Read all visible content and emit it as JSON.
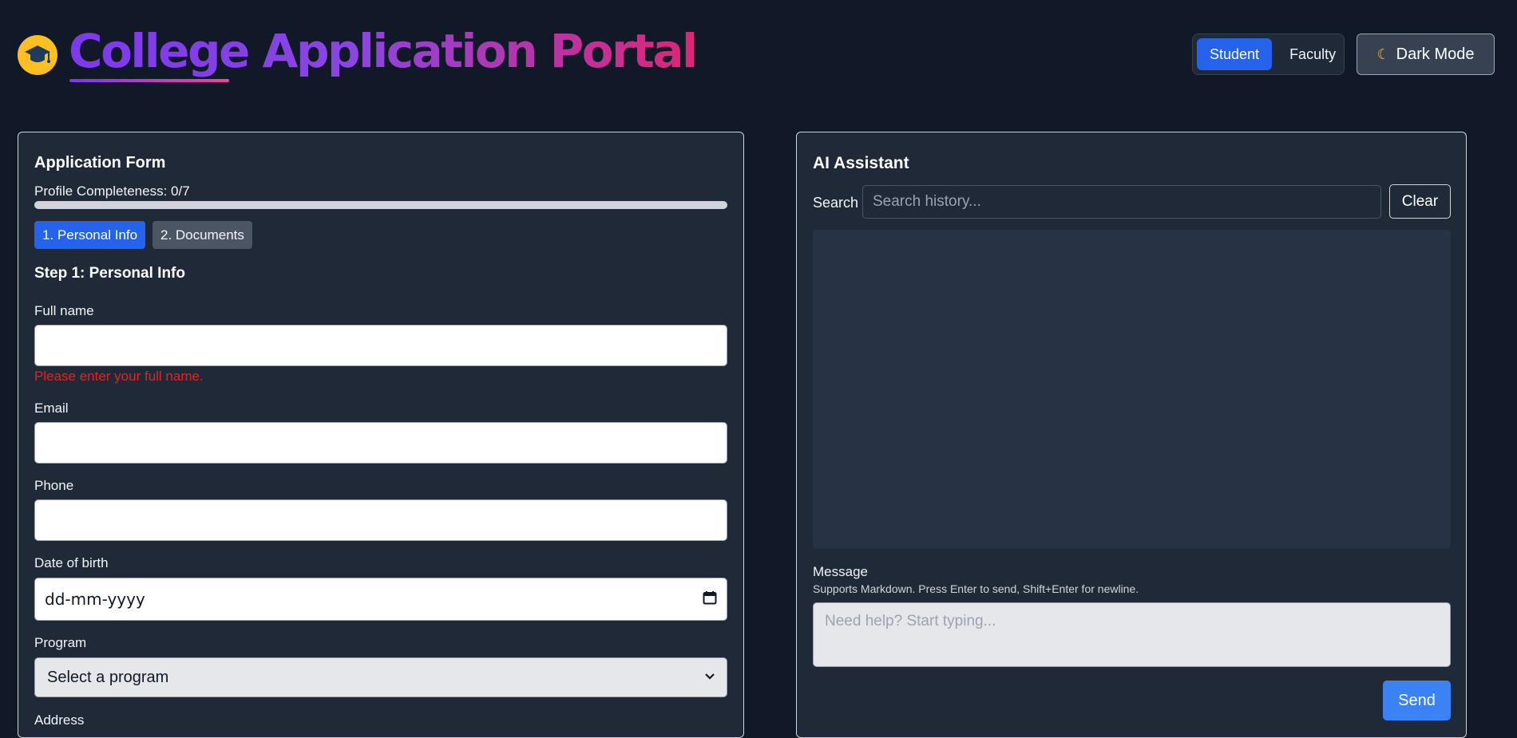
{
  "header": {
    "title": "College Application Portal",
    "roles": [
      "Student",
      "Faculty"
    ],
    "active_role": "Student",
    "dark_mode_label": "Dark Mode"
  },
  "form": {
    "title": "Application Form",
    "completeness_label": "Profile Completeness: 0/7",
    "completeness_fraction": 0,
    "steps": [
      "1. Personal Info",
      "2. Documents"
    ],
    "active_step": "1. Personal Info",
    "step_heading": "Step 1: Personal Info",
    "full_name": {
      "label": "Full name",
      "value": "",
      "error": "Please enter your full name."
    },
    "email": {
      "label": "Email",
      "value": ""
    },
    "phone": {
      "label": "Phone",
      "value": ""
    },
    "dob": {
      "label": "Date of birth",
      "placeholder": "dd-mm-yyyy"
    },
    "program": {
      "label": "Program",
      "selected": "Select a program"
    },
    "address": {
      "label": "Address"
    }
  },
  "assistant": {
    "title": "AI Assistant",
    "search_label": "Search",
    "search_placeholder": "Search history...",
    "clear_label": "Clear",
    "message_label": "Message",
    "message_hint": "Supports Markdown. Press Enter to send, Shift+Enter for newline.",
    "message_placeholder": "Need help? Start typing...",
    "send_label": "Send"
  },
  "colors": {
    "background": "#111827",
    "panel": "#1f2937",
    "accent": "#2563eb",
    "error": "#dc2626",
    "title_gradient_start": "#7c3aed",
    "title_gradient_end": "#db2777",
    "logo": "#fbbf24"
  },
  "icons": {
    "logo": "graduation-cap-icon",
    "dark_mode": "moon-icon",
    "date": "calendar-icon",
    "select": "chevron-down-icon"
  }
}
